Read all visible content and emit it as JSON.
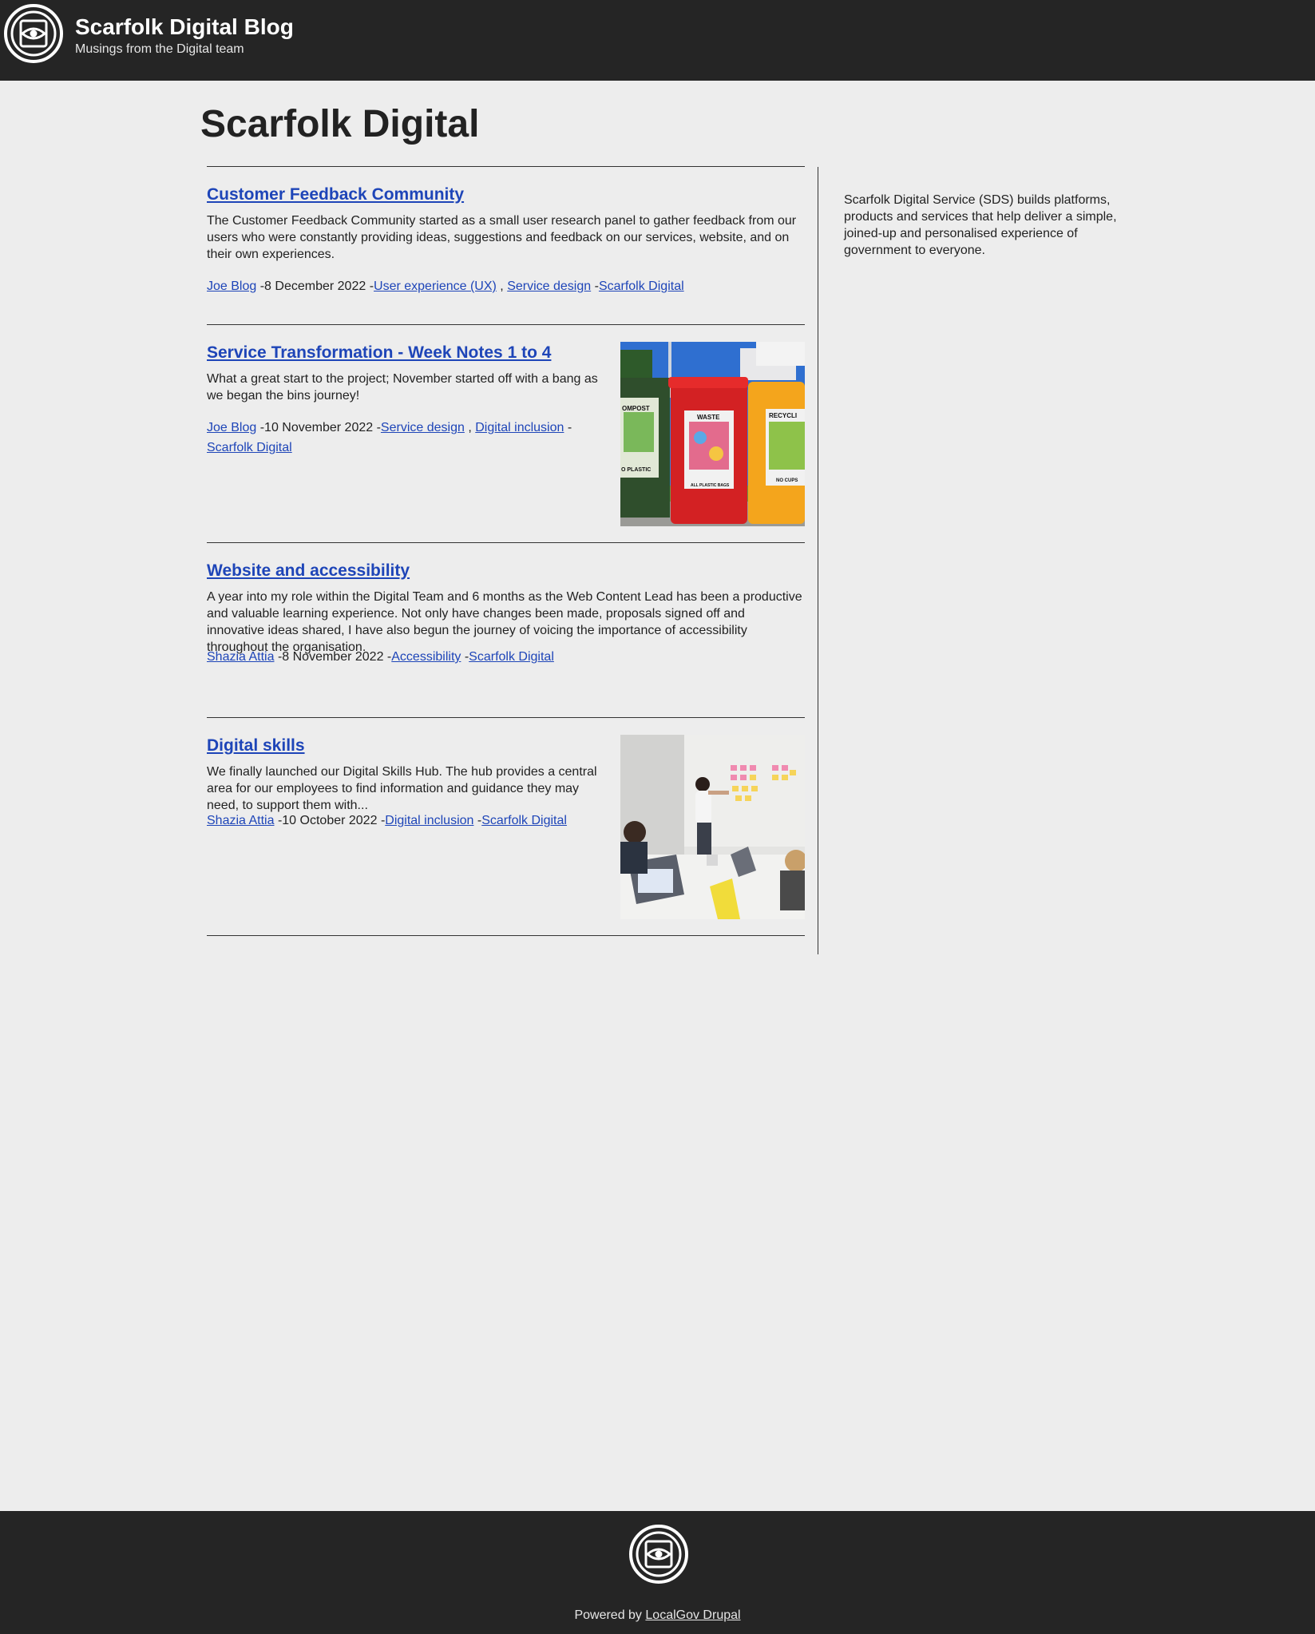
{
  "header": {
    "site_title": "Scarfolk Digital Blog",
    "slogan": "Musings from the Digital team"
  },
  "page_title": "Scarfolk Digital",
  "sidebar": {
    "text": "Scarfolk Digital Service (SDS) builds platforms, products and services that help deliver a simple, joined-up and personalised experience of government to everyone."
  },
  "posts": [
    {
      "title": "Customer Feedback Community",
      "summary": "The Customer Feedback Community started as a small user research panel to gather feedback from our users who were constantly providing ideas, suggestions and feedback on our services, website, and on their own experiences.",
      "author": "Joe Blog",
      "date": "8 December 2022",
      "tags": [
        "User experience (UX)",
        "Service design"
      ],
      "channel": "Scarfolk Digital"
    },
    {
      "title": "Service Transformation - Week Notes 1 to 4",
      "summary": "What a great start to the project; November started off with a bang as we began the bins journey!",
      "author": "Joe Blog",
      "date": "10 November 2022",
      "tags": [
        "Service design",
        "Digital inclusion"
      ],
      "channel": "Scarfolk Digital",
      "image": {
        "bin_labels": [
          "OMPOST",
          "WASTE",
          "RECYCLI",
          "O PLASTIC",
          "ALL PLASTIC BAGS",
          "NO CUPS"
        ]
      }
    },
    {
      "title": "Website and accessibility",
      "summary": "A year into my role within the Digital Team and 6 months as the Web Content Lead has been a productive and valuable learning experience. Not only have changes been made, proposals signed off and innovative ideas shared, I have also begun the journey of voicing the importance of accessibility throughout the organisation.",
      "author": "Shazia Attia",
      "date": "8 November 2022",
      "tags": [
        "Accessibility"
      ],
      "channel": "Scarfolk Digital"
    },
    {
      "title": "Digital skills",
      "summary": "We finally launched our Digital Skills Hub. The hub provides a central area for our employees to find information and guidance they may need, to support them with...",
      "author": "Shazia Attia",
      "date": "10 October 2022",
      "tags": [
        "Digital inclusion"
      ],
      "channel": "Scarfolk Digital"
    }
  ],
  "separators": {
    "dash": "-",
    "comma": ","
  },
  "footer": {
    "powered_by": "Powered by",
    "link": "LocalGov Drupal"
  },
  "colors": {
    "header_bg": "#252525",
    "page_bg": "#ededed",
    "link": "#1e45b8"
  }
}
